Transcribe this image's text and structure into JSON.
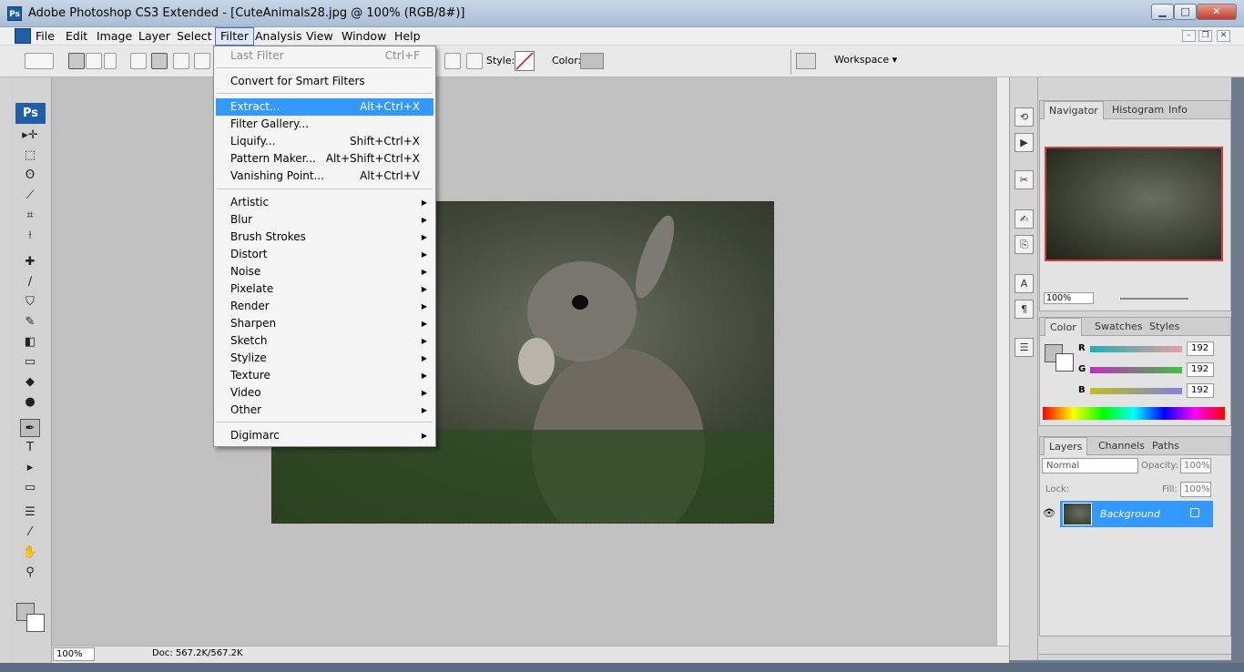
{
  "window": {
    "title": "Adobe Photoshop CS3 Extended - [CuteAnimals28.jpg @ 100% (RGB/8#)]",
    "app_icon": "Ps",
    "minimize": "▁",
    "maximize": "□",
    "close": "✕"
  },
  "menubar": {
    "items": [
      {
        "label": "File"
      },
      {
        "label": "Edit"
      },
      {
        "label": "Image"
      },
      {
        "label": "Layer"
      },
      {
        "label": "Select"
      },
      {
        "label": "Filter"
      },
      {
        "label": "Analysis"
      },
      {
        "label": "View"
      },
      {
        "label": "Window"
      },
      {
        "label": "Help"
      }
    ],
    "active": "Filter",
    "doc_min": "–",
    "doc_restore": "❐",
    "doc_close": "✕"
  },
  "options": {
    "style_label": "Style:",
    "color_label": "Color:",
    "workspace_label": "Workspace ▾"
  },
  "toolbox": {
    "logo": "Ps",
    "tools": [
      "▸✛",
      "⬚",
      "ʘ",
      "⟋",
      "⌗",
      "⟊",
      "✚",
      "∕",
      "⛉",
      "✎",
      "◧",
      "▭",
      "◆",
      "●",
      "✒",
      "T",
      "▸",
      "▭",
      "☰",
      "⁄",
      "✋",
      "⚲"
    ]
  },
  "status": {
    "zoom": "100%",
    "doc": "Doc: 567.2K/567.2K"
  },
  "filter_menu": {
    "items": [
      {
        "label": "Last Filter",
        "shortcut": "Ctrl+F",
        "disabled": true
      },
      {
        "label": "Convert for Smart Filters",
        "shortcut": ""
      },
      {
        "label": "Extract...",
        "shortcut": "Alt+Ctrl+X",
        "highlighted": true
      },
      {
        "label": "Filter Gallery...",
        "shortcut": ""
      },
      {
        "label": "Liquify...",
        "shortcut": "Shift+Ctrl+X"
      },
      {
        "label": "Pattern Maker...",
        "shortcut": "Alt+Shift+Ctrl+X"
      },
      {
        "label": "Vanishing Point...",
        "shortcut": "Alt+Ctrl+V"
      },
      {
        "label": "Artistic",
        "submenu": true
      },
      {
        "label": "Blur",
        "submenu": true
      },
      {
        "label": "Brush Strokes",
        "submenu": true
      },
      {
        "label": "Distort",
        "submenu": true
      },
      {
        "label": "Noise",
        "submenu": true
      },
      {
        "label": "Pixelate",
        "submenu": true
      },
      {
        "label": "Render",
        "submenu": true
      },
      {
        "label": "Sharpen",
        "submenu": true
      },
      {
        "label": "Sketch",
        "submenu": true
      },
      {
        "label": "Stylize",
        "submenu": true
      },
      {
        "label": "Texture",
        "submenu": true
      },
      {
        "label": "Video",
        "submenu": true
      },
      {
        "label": "Other",
        "submenu": true
      },
      {
        "label": "Digimarc",
        "submenu": true
      }
    ]
  },
  "navigator": {
    "tabs": [
      "Navigator",
      "Histogram",
      "Info"
    ],
    "zoom": "100%"
  },
  "color_panel": {
    "tabs": [
      "Color",
      "Swatches",
      "Styles"
    ],
    "channels": [
      {
        "label": "R",
        "value": "192",
        "bar": "#e8a0a0"
      },
      {
        "label": "G",
        "value": "192",
        "bar": "#b060c0"
      },
      {
        "label": "B",
        "value": "192",
        "bar": "#c8c060"
      }
    ]
  },
  "layers_panel": {
    "tabs": [
      "Layers",
      "Channels",
      "Paths"
    ],
    "blend_mode": "Normal",
    "opacity_label": "Opacity:",
    "opacity": "100%",
    "lock_label": "Lock:",
    "fill_label": "Fill:",
    "fill": "100%",
    "layers": [
      {
        "name": "Background",
        "locked": true
      }
    ]
  },
  "colors": {
    "accent": "#3399ff",
    "titlebar": "#b9cade",
    "canvas_bg": "#c0c0c0"
  }
}
